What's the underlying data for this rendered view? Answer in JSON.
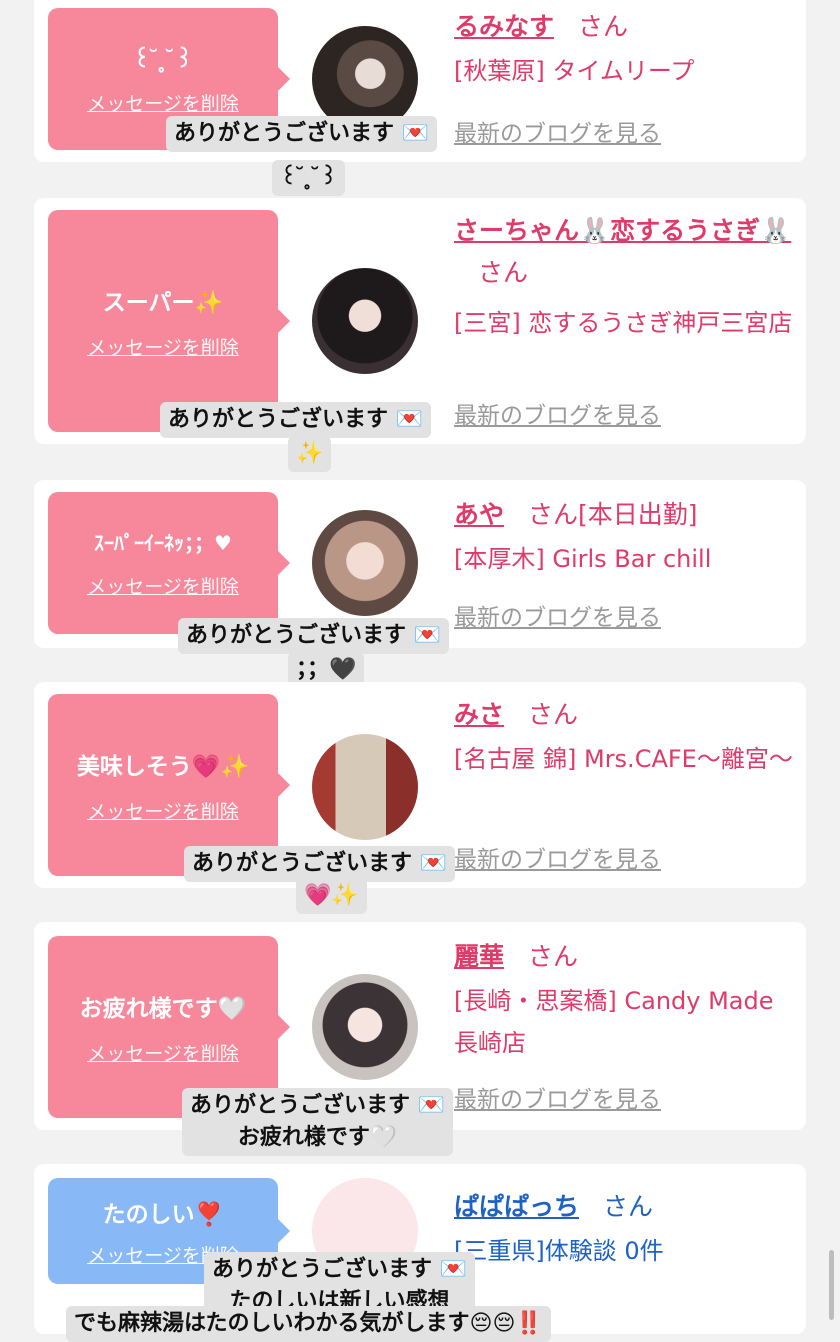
{
  "delete_label": "メッセージを削除",
  "blog_label": "最新のブログを見る",
  "honorific": "さん",
  "cards": [
    {
      "message": "꒰ ̆ ̥̥ ̆꒱",
      "name": "るみなす",
      "shop": "[秋葉原] タイムリープ",
      "caption": [
        "ありがとうございます 💌",
        "꒰ ̆ ̥̥ ̆꒱"
      ]
    },
    {
      "message": "スーパー✨",
      "name": "さーちゃん🐰恋するうさぎ🐰",
      "shop": "[三宮] 恋するうさぎ神戸三宮店",
      "caption": [
        "ありがとうございます 💌",
        "✨"
      ]
    },
    {
      "message": "ｽｰﾊﾟｰｲｰﾈｯ；；♥",
      "name": "あや",
      "extra": "[本日出勤]",
      "shop": "[本厚木] Girls Bar chill",
      "caption": [
        "ありがとうございます 💌",
        "；；🖤"
      ]
    },
    {
      "message": "美味しそう💗✨",
      "name": "みさ",
      "shop": "[名古屋 錦] Mrs.CAFE〜離宮〜",
      "caption": [
        "ありがとうございます 💌",
        "💗✨"
      ]
    },
    {
      "message": "お疲れ様です🤍",
      "name": "麗華",
      "shop": "[長崎・思案橋] Candy Made 長崎店",
      "caption": [
        "ありがとうございます 💌",
        "お疲れ様です🤍"
      ]
    },
    {
      "message": "たのしい❣️",
      "name": "ぱぱぱっち",
      "shop": "[三重県]体験談 0件",
      "caption": [
        "ありがとうございます 💌",
        "たのしいは新しい感想",
        "でも麻辣湯はたのしいわかる気がします😔😔‼️"
      ]
    }
  ]
}
